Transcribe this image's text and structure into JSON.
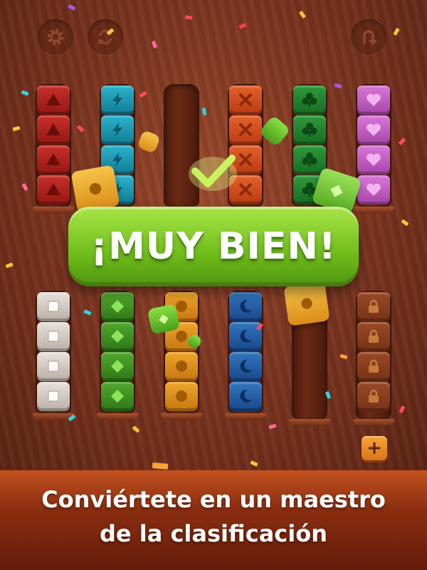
{
  "colors": {
    "banner_green": "#7ac823",
    "footer_orange": "#b8461a",
    "board_wood": "#7d3620",
    "add_button": "#f0962e"
  },
  "toolbar": {
    "settings_icon": "gear-icon",
    "restart_icon": "refresh-icon",
    "undo_icon": "undo-icon"
  },
  "banner": {
    "text": "¡MUY BIEN!"
  },
  "top_tubes": [
    {
      "color": "red",
      "symbol": "triangle",
      "blocks": 4
    },
    {
      "color": "cyan",
      "symbol": "bolt",
      "blocks": 4
    },
    {
      "color": "empty",
      "symbol": "none",
      "blocks": 0
    },
    {
      "color": "orange",
      "symbol": "x",
      "blocks": 4
    },
    {
      "color": "green",
      "symbol": "club",
      "blocks": 4
    },
    {
      "color": "pink",
      "symbol": "heart",
      "blocks": 4
    }
  ],
  "bottom_tubes": [
    {
      "color": "white",
      "symbol": "square",
      "blocks": 4
    },
    {
      "color": "green",
      "symbol": "diamond",
      "blocks": 4
    },
    {
      "color": "yellow",
      "symbol": "circle",
      "blocks": 4
    },
    {
      "color": "blue",
      "symbol": "moon",
      "blocks": 4
    },
    {
      "color": "empty",
      "symbol": "none",
      "blocks": 0
    },
    {
      "color": "locked",
      "symbol": "lock",
      "blocks": 4
    }
  ],
  "add_tube_button": {
    "label": "+"
  },
  "footer": {
    "line1": "Conviértete en un maestro",
    "line2": "de la clasificación"
  }
}
